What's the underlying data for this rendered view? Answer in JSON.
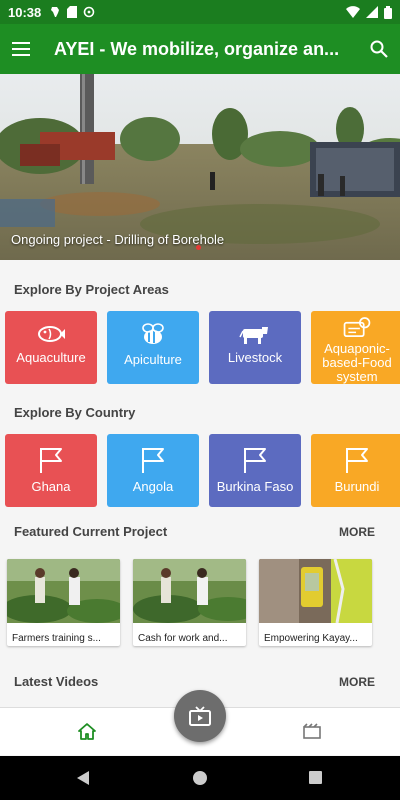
{
  "status_bar": {
    "time": "10:38"
  },
  "app_bar": {
    "title": "AYEI - We mobilize, organize an..."
  },
  "hero": {
    "caption": "Ongoing project - Drilling of Borehole"
  },
  "sections": {
    "project_areas": "Explore By Project Areas",
    "country": "Explore By Country",
    "featured": "Featured Current Project",
    "videos": "Latest Videos",
    "more_label": "MORE"
  },
  "project_areas": [
    {
      "label": "Aquaculture",
      "color": "#e85154",
      "icon": "fish-icon"
    },
    {
      "label": "Apiculture",
      "color": "#3fa8ef",
      "icon": "bee-icon"
    },
    {
      "label": "Livestock",
      "color": "#5c6bc0",
      "icon": "cow-icon"
    },
    {
      "label": "Aquaponic-based-Food system",
      "color": "#f9a825",
      "icon": "food-system-icon"
    }
  ],
  "countries": [
    {
      "label": "Ghana",
      "color": "#e85154",
      "icon": "flag-icon"
    },
    {
      "label": "Angola",
      "color": "#3fa8ef",
      "icon": "flag-icon"
    },
    {
      "label": "Burkina Faso",
      "color": "#5c6bc0",
      "icon": "flag-icon"
    },
    {
      "label": "Burundi",
      "color": "#f9a825",
      "icon": "flag-icon"
    }
  ],
  "featured_projects": [
    {
      "title": "Farmers training s..."
    },
    {
      "title": "Cash for work and..."
    },
    {
      "title": "Empowering Kayay..."
    }
  ]
}
